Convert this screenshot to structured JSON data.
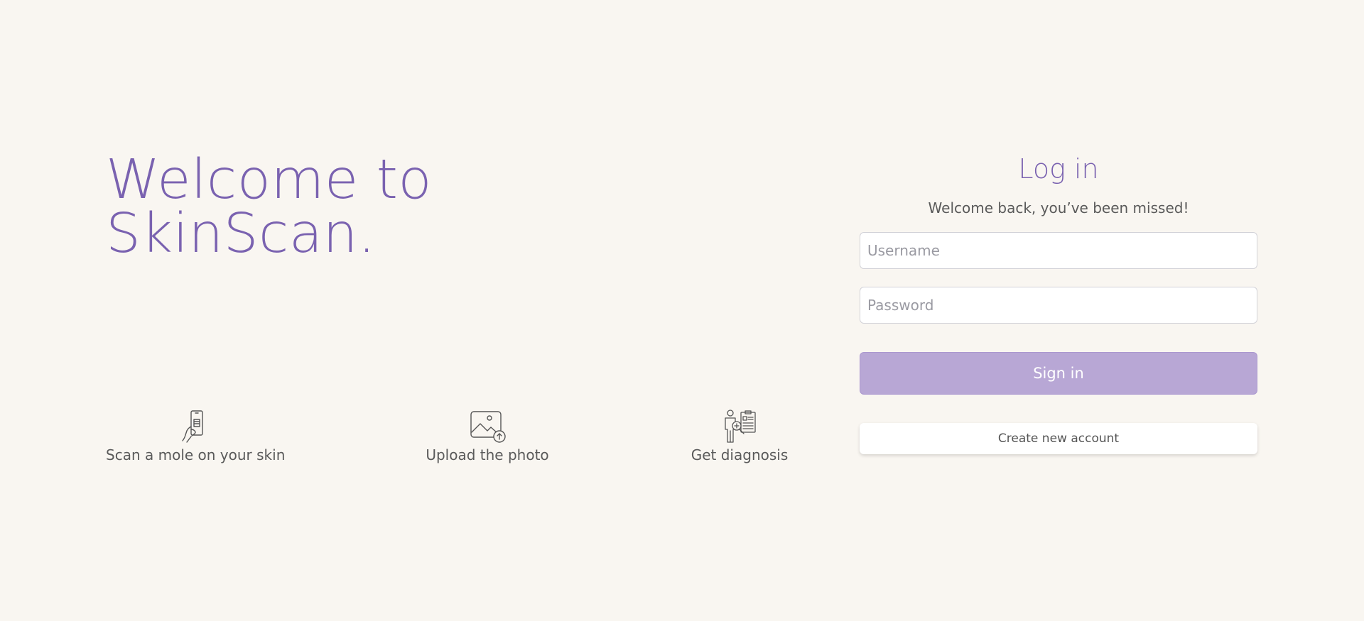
{
  "hero": {
    "line1": "Welcome to",
    "line2": "SkinScan."
  },
  "steps": [
    {
      "icon": "phone-scan-icon",
      "label": "Scan a mole on your skin"
    },
    {
      "icon": "image-upload-icon",
      "label": "Upload the photo"
    },
    {
      "icon": "doctor-report-icon",
      "label": "Get diagnosis"
    }
  ],
  "login": {
    "title": "Log in",
    "subtitle": "Welcome back, you’ve been missed!",
    "username_placeholder": "Username",
    "password_placeholder": "Password",
    "signin_label": "Sign in",
    "create_account_label": "Create new account"
  },
  "colors": {
    "background": "#f9f6f1",
    "accent": "#7a62b0",
    "button_fill": "#b8a7d5"
  }
}
